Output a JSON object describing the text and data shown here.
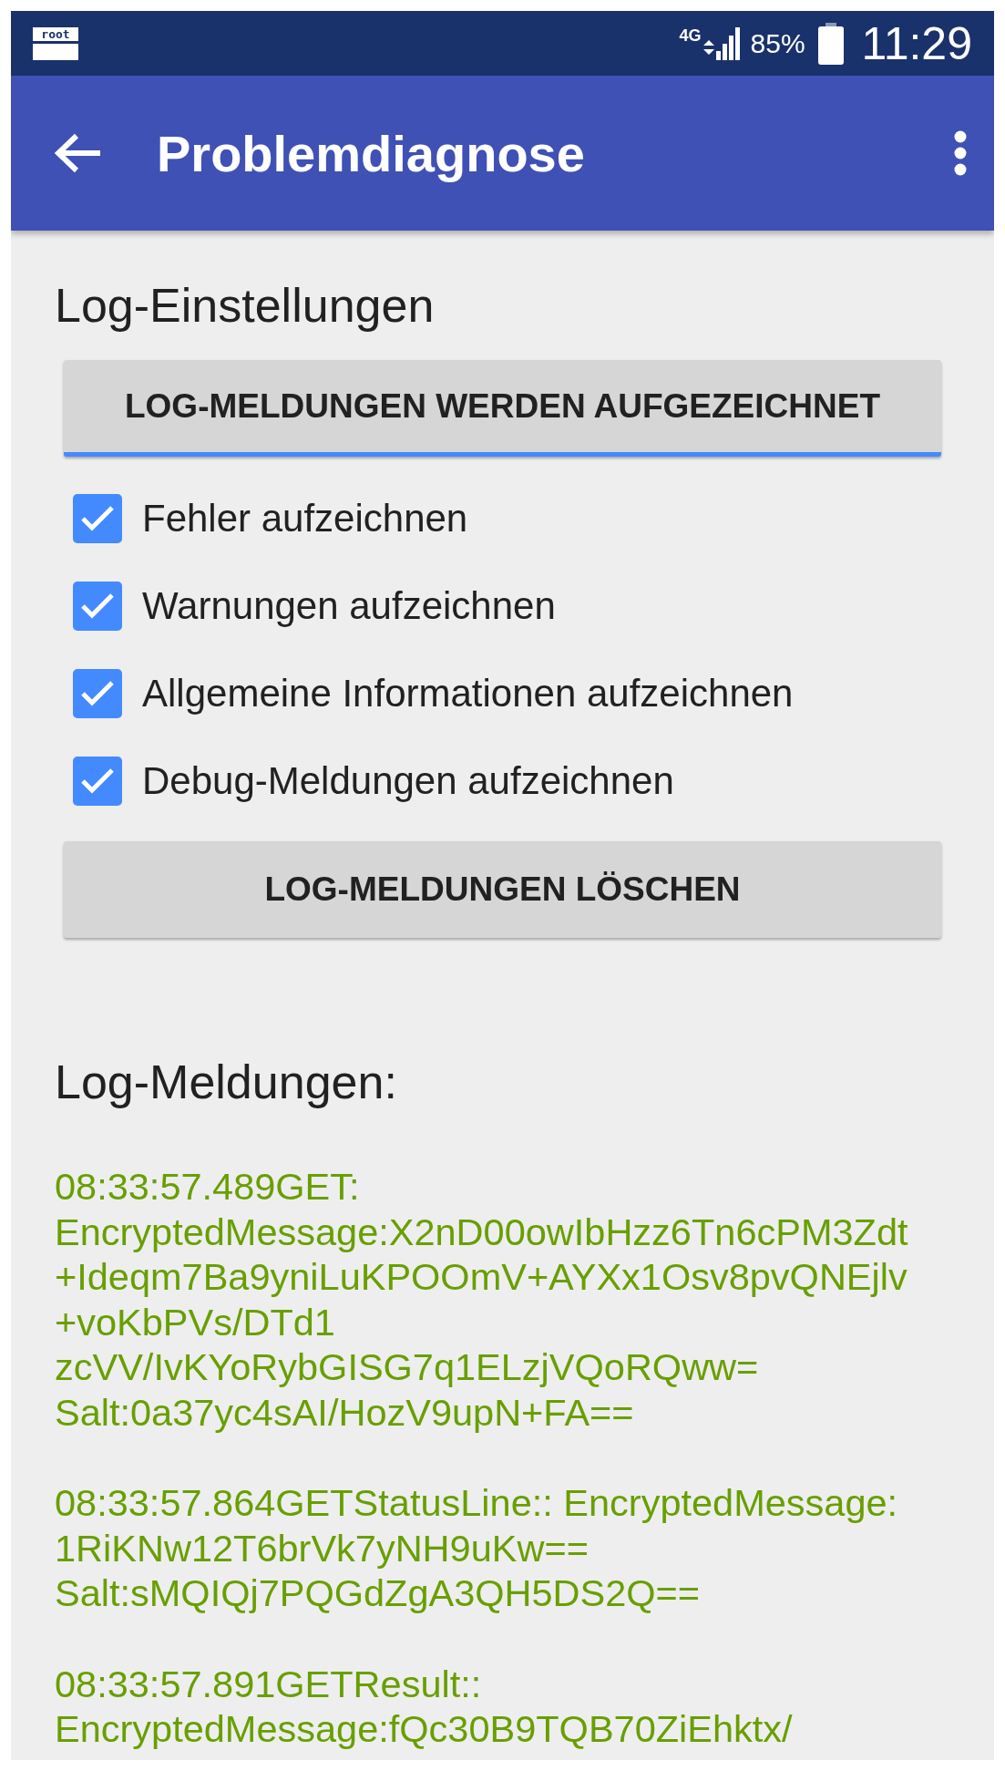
{
  "status_bar": {
    "root_badge": "root",
    "network": "4G",
    "battery": "85%",
    "time": "11:29"
  },
  "app_bar": {
    "title": "Problemdiagnose"
  },
  "settings": {
    "heading": "Log-Einstellungen",
    "toggle_button": {
      "label": "LOG-MELDUNGEN WERDEN AUFGEZEICHNET",
      "on": true
    },
    "options": [
      {
        "label": "Fehler aufzeichnen",
        "checked": true
      },
      {
        "label": "Warnungen aufzeichnen",
        "checked": true
      },
      {
        "label": "Allgemeine Informationen aufzeichnen",
        "checked": true
      },
      {
        "label": "Debug-Meldungen aufzeichnen",
        "checked": true
      }
    ],
    "clear_button": "LOG-MELDUNGEN LÖSCHEN"
  },
  "log": {
    "heading": "Log-Meldungen:",
    "entries": [
      {
        "lines": [
          "08:33:57.489GET:",
          "EncryptedMessage:X2nD00owIbHzz6Tn6cPM3Zdt",
          "+Ideqm7Ba9yniLuKPOOmV+AYXx1Osv8pvQNEjlv",
          "+voKbPVs/DTd1",
          "zcVV/IvKYoRybGISG7q1ELzjVQoRQww=",
          "Salt:0a37yc4sAI/HozV9upN+FA=="
        ]
      },
      {
        "lines": [
          "08:33:57.864GETStatusLine:: EncryptedMessage:",
          "1RiKNw12T6brVk7yNH9uKw==",
          "Salt:sMQIQj7PQGdZgA3QH5DS2Q=="
        ]
      },
      {
        "lines": [
          "08:33:57.891GETResult::",
          "EncryptedMessage:fQc30B9TQB70ZiEhktx/"
        ]
      }
    ]
  }
}
